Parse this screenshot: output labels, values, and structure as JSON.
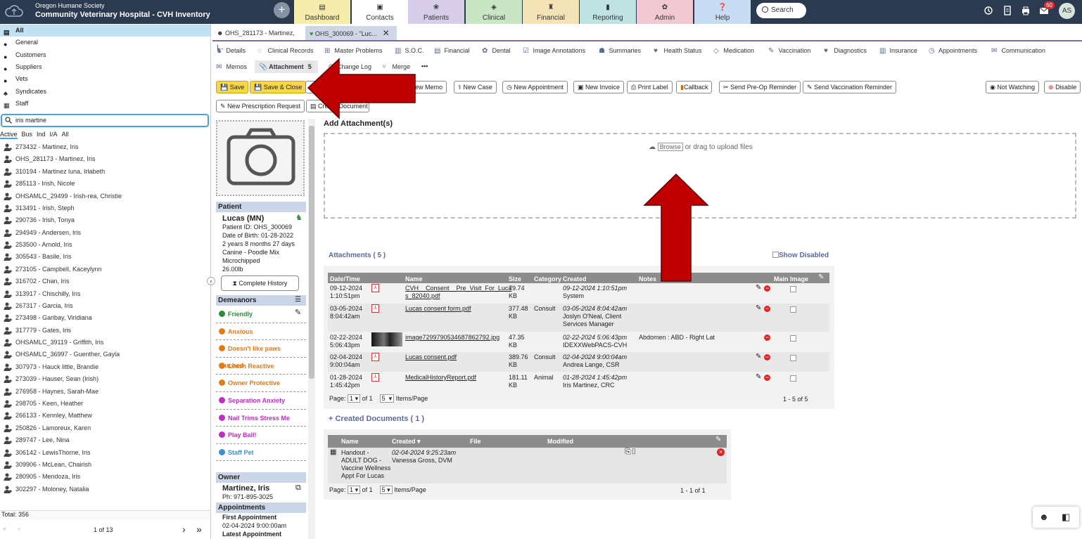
{
  "header": {
    "org_line1": "Oregon Humane Society",
    "org_line2": "Community Veterinary Hospital - CVH Inventory",
    "nav": [
      {
        "label": "Dashboard",
        "color": "#f6ecab",
        "icon": "dashboard-icon"
      },
      {
        "label": "Contacts",
        "color": "#ffffff",
        "icon": "contacts-icon"
      },
      {
        "label": "Patients",
        "color": "#d8cde9",
        "icon": "paw-icon"
      },
      {
        "label": "Clinical",
        "color": "#c9e6c4",
        "icon": "clinical-icon"
      },
      {
        "label": "Financial",
        "color": "#f3e3b6",
        "icon": "financial-icon"
      },
      {
        "label": "Reporting",
        "color": "#bfe2e2",
        "icon": "chart-icon"
      },
      {
        "label": "Admin",
        "color": "#f2c9d2",
        "icon": "gear-icon"
      },
      {
        "label": "Help",
        "color": "#c7dcf3",
        "icon": "help-icon"
      }
    ],
    "search_label": "Search",
    "notifications": "60",
    "user_initials": "AS"
  },
  "left": {
    "categories": [
      "All",
      "General",
      "Customers",
      "Suppliers",
      "Vets",
      "Syndicates",
      "Staff"
    ],
    "search_value": "iris martine",
    "filters": [
      "Active",
      "Bus",
      "Ind",
      "I/A",
      "All"
    ],
    "clients": [
      "273432 - Martinez, Iris",
      "OHS_281173 - Martinez, Iris",
      "310194 - Martinez luna, Irlabeth",
      "285113 - Irish, Nicole",
      "OHSAMLC_29499 - Irish-rea, Christie",
      "313491 - Irish, Steph",
      "290736 - Irish, Tonya",
      "294949 - Andersen, Iris",
      "253500 - Arnold, Iris",
      "305543 - Basile, Iris",
      "273105 - Campbell, Kaceylynn",
      "316702 - Chan, Iris",
      "313917 - Chischilly, Iris",
      "267317 - Garcia, Iris",
      "273498 - Garibay, Viridiana",
      "317779 - Gates, Iris",
      "OHSAMLC_39119 - Griffith, Iris",
      "OHSAMLC_36997 - Guenther, Gayla",
      "307973 - Hauck little, Brandie",
      "273039 - Hauser, Sean (Irish)",
      "276958 - Haynes, Sarah-Mae",
      "298705 - Keen, Heather",
      "266133 - Kennley, Matthew",
      "250826 - Lamoreux, Karen",
      "289747 - Lee, Nina",
      "306142 - LewisThorne, Iris",
      "309906 - McLean, Chairish",
      "280905 - Mendoza, Iris",
      "302297 - Moloney, Natalia"
    ],
    "total": "Total: 356",
    "page": "1 of 13"
  },
  "record_tabs": [
    "OHS_281173 - Martinez, I...",
    "OHS_300069 - \"Luc..."
  ],
  "subnav_row1": [
    "Details",
    "Clinical Records",
    "Master Problems",
    "S.O.C.",
    "Financial",
    "Dental",
    "Image Annotations",
    "Summaries",
    "Health Status",
    "Medication",
    "Vaccination",
    "Diagnostics",
    "Insurance",
    "Appointments",
    "Communication"
  ],
  "subnav_row2": {
    "memos": "Memos",
    "attachment": "Attachment",
    "attachment_count": "5",
    "changelog": "Change Log",
    "merge": "Merge",
    "more": "•••"
  },
  "toolbar": {
    "save": "Save",
    "save_close": "Save & Close",
    "new_memo": "New Memo",
    "new_case": "New Case",
    "new_appointment": "New Appointment",
    "new_invoice": "New Invoice",
    "print_label": "Print Label",
    "callback": "Callback",
    "send_preop": "Send Pre-Op Reminder",
    "send_vacc": "Send Vaccination Reminder",
    "not_watching": "Not Watching",
    "disable": "Disable",
    "new_rx": "New Prescription Request",
    "create_doc_partial": "Cre",
    "create_doc_tail": "Document"
  },
  "patient": {
    "section": "Patient",
    "name": "Lucas (MN)",
    "id": "Patient ID: OHS_300069",
    "dob": "Date of Birth: 01-28-2022",
    "age": "2 years 8 months 27 days",
    "breed": "Canine - Poodle Mix",
    "micro": "Microchipped",
    "weight": "26.00lb",
    "history_btn": "Complete History"
  },
  "demeanors": {
    "title": "Demeanors",
    "items": [
      {
        "label": "Friendly",
        "color": "#2e8b3a"
      },
      {
        "label": "Anxious",
        "color": "#e07b1a"
      },
      {
        "label": "Doesn't like paws touched",
        "color": "#e07b1a"
      },
      {
        "label": "Leash Reactive",
        "color": "#e07b1a"
      },
      {
        "label": "Owner Protective",
        "color": "#e07b1a"
      },
      {
        "label": "Separation Anxiety",
        "color": "#c02cc8"
      },
      {
        "label": "Nail Trims Stress Me",
        "color": "#c02cc8"
      },
      {
        "label": "Play Ball!",
        "color": "#c02cc8"
      },
      {
        "label": "Staff Pet",
        "color": "#3a8fd6"
      }
    ]
  },
  "owner": {
    "section": "Owner",
    "name": "Martinez, Iris",
    "phone": "Ph: 971-895-3025"
  },
  "appointments": {
    "section": "Appointments",
    "first_label": "First Appointment",
    "first_value": "02-04-2024 9:00:00am",
    "latest_label": "Latest Appointment"
  },
  "add_attachment": {
    "title": "Add Attachment(s)",
    "browse": "Browse",
    "drag_text": "or drag to upload files"
  },
  "attachments": {
    "title": "Attachments ( 5 )",
    "show_disabled": "Show Disabled",
    "columns": [
      "Date/Time",
      "Name",
      "Size",
      "Category",
      "Created",
      "Notes",
      "Main Image"
    ],
    "rows": [
      {
        "date": "09-12-2024",
        "time": "1:10:51pm",
        "name1": "CVH__Consent__Pre_Visit_For_Luca",
        "name2": "s_82040.pdf",
        "size1": "79.74",
        "size2": "KB",
        "category": "",
        "created1": "09-12-2024 1:10:51pm",
        "created2": "System",
        "created3": "",
        "notes": "",
        "kind": "pdf"
      },
      {
        "date": "03-05-2024",
        "time": "8:04:42am",
        "name1": "Lucas consent form.pdf",
        "name2": "",
        "size1": "377.48",
        "size2": "KB",
        "category": "Consult",
        "created1": "03-05-2024 8:04:42am",
        "created2": "Joslyn O'Neal, Client",
        "created3": "Services Manager",
        "notes": "",
        "kind": "pdf"
      },
      {
        "date": "02-22-2024",
        "time": "5:06:43pm",
        "name1": "image7299790534687862792.jpg",
        "name2": "",
        "size1": "47.35",
        "size2": "KB",
        "category": "",
        "created1": "02-22-2024 5:06:43pm",
        "created2": "IDEXXWebPACS-CVH",
        "created3": "",
        "notes": "Abdomen : ABD - Right Lat",
        "kind": "img"
      },
      {
        "date": "02-04-2024",
        "time": "9:00:04am",
        "name1": "Lucas consent.pdf",
        "name2": "",
        "size1": "389.76",
        "size2": "KB",
        "category": "Consult",
        "created1": "02-04-2024 9:00:04am",
        "created2": "Andrea Lange, CSR",
        "created3": "",
        "notes": "",
        "kind": "pdf"
      },
      {
        "date": "01-28-2024",
        "time": "1:45:42pm",
        "name1": "MedicalHistoryReport.pdf",
        "name2": "",
        "size1": "181.11",
        "size2": "KB",
        "category": "Animal",
        "created1": "01-28-2024 1:45:42pm",
        "created2": "Iris Martinez, CRC",
        "created3": "",
        "notes": "",
        "kind": "pdf"
      }
    ],
    "page_label": "Page:",
    "page_value": "1",
    "of": "of 1",
    "per_page": "5",
    "items_page": "Items/Page",
    "range": "1 - 5 of 5"
  },
  "created_docs": {
    "title": "Created Documents ( 1 )",
    "columns": [
      "Name",
      "Created",
      "File",
      "Modified"
    ],
    "row": {
      "name": [
        "Handout -",
        "ADULT DOG -",
        "Vaccine Wellness",
        "Appt For Lucas"
      ],
      "created1": "02-04-2024 9:25:23am",
      "created2": "Vanessa Gross, DVM"
    },
    "page_label": "Page:",
    "page_value": "1",
    "of": "of 1",
    "per_page": "5",
    "items_page": "Items/Page",
    "range": "1 - 1 of 1"
  },
  "colors": {
    "topbar": "#2b3a4e",
    "accent": "#4aa3d9",
    "arrow": "#c00000",
    "save": "#f7d64a"
  }
}
